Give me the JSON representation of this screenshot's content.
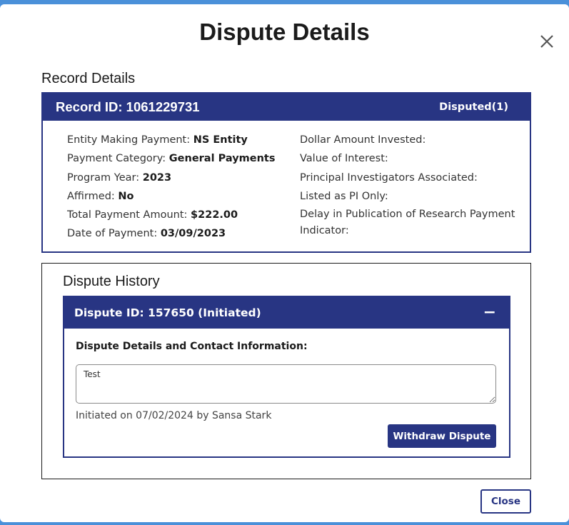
{
  "modal": {
    "title": "Dispute Details",
    "close_icon": "close-icon"
  },
  "record": {
    "heading": "Record Details",
    "id_label": "Record ID: 1061229731",
    "status": "Disputed(1)",
    "left": [
      {
        "label": "Entity Making Payment:",
        "value": "NS Entity"
      },
      {
        "label": "Payment Category:",
        "value": "General Payments"
      },
      {
        "label": "Program Year:",
        "value": "2023"
      },
      {
        "label": "Affirmed:",
        "value": "No"
      },
      {
        "label": "Total Payment Amount:",
        "value": "$222.00"
      },
      {
        "label": "Date of Payment:",
        "value": "03/09/2023"
      }
    ],
    "right": [
      {
        "label": "Dollar Amount Invested:",
        "value": ""
      },
      {
        "label": "Value of Interest:",
        "value": ""
      },
      {
        "label": "Principal Investigators Associated:",
        "value": ""
      },
      {
        "label": "Listed as PI Only:",
        "value": ""
      },
      {
        "label": "Delay in Publication of Research Payment Indicator:",
        "value": ""
      }
    ]
  },
  "history": {
    "heading": "Dispute History",
    "dispute": {
      "id_label": "Dispute ID: 157650 (Initiated)",
      "toggle": "−",
      "contact_label": "Dispute Details and Contact Information:",
      "details_value": "Test",
      "initiated_text": "Initiated on 07/02/2024 by Sansa Stark",
      "withdraw_label": "Withdraw Dispute"
    }
  },
  "footer": {
    "close_label": "Close"
  },
  "colors": {
    "primary": "#283583",
    "backdrop": "#4a90d9"
  }
}
